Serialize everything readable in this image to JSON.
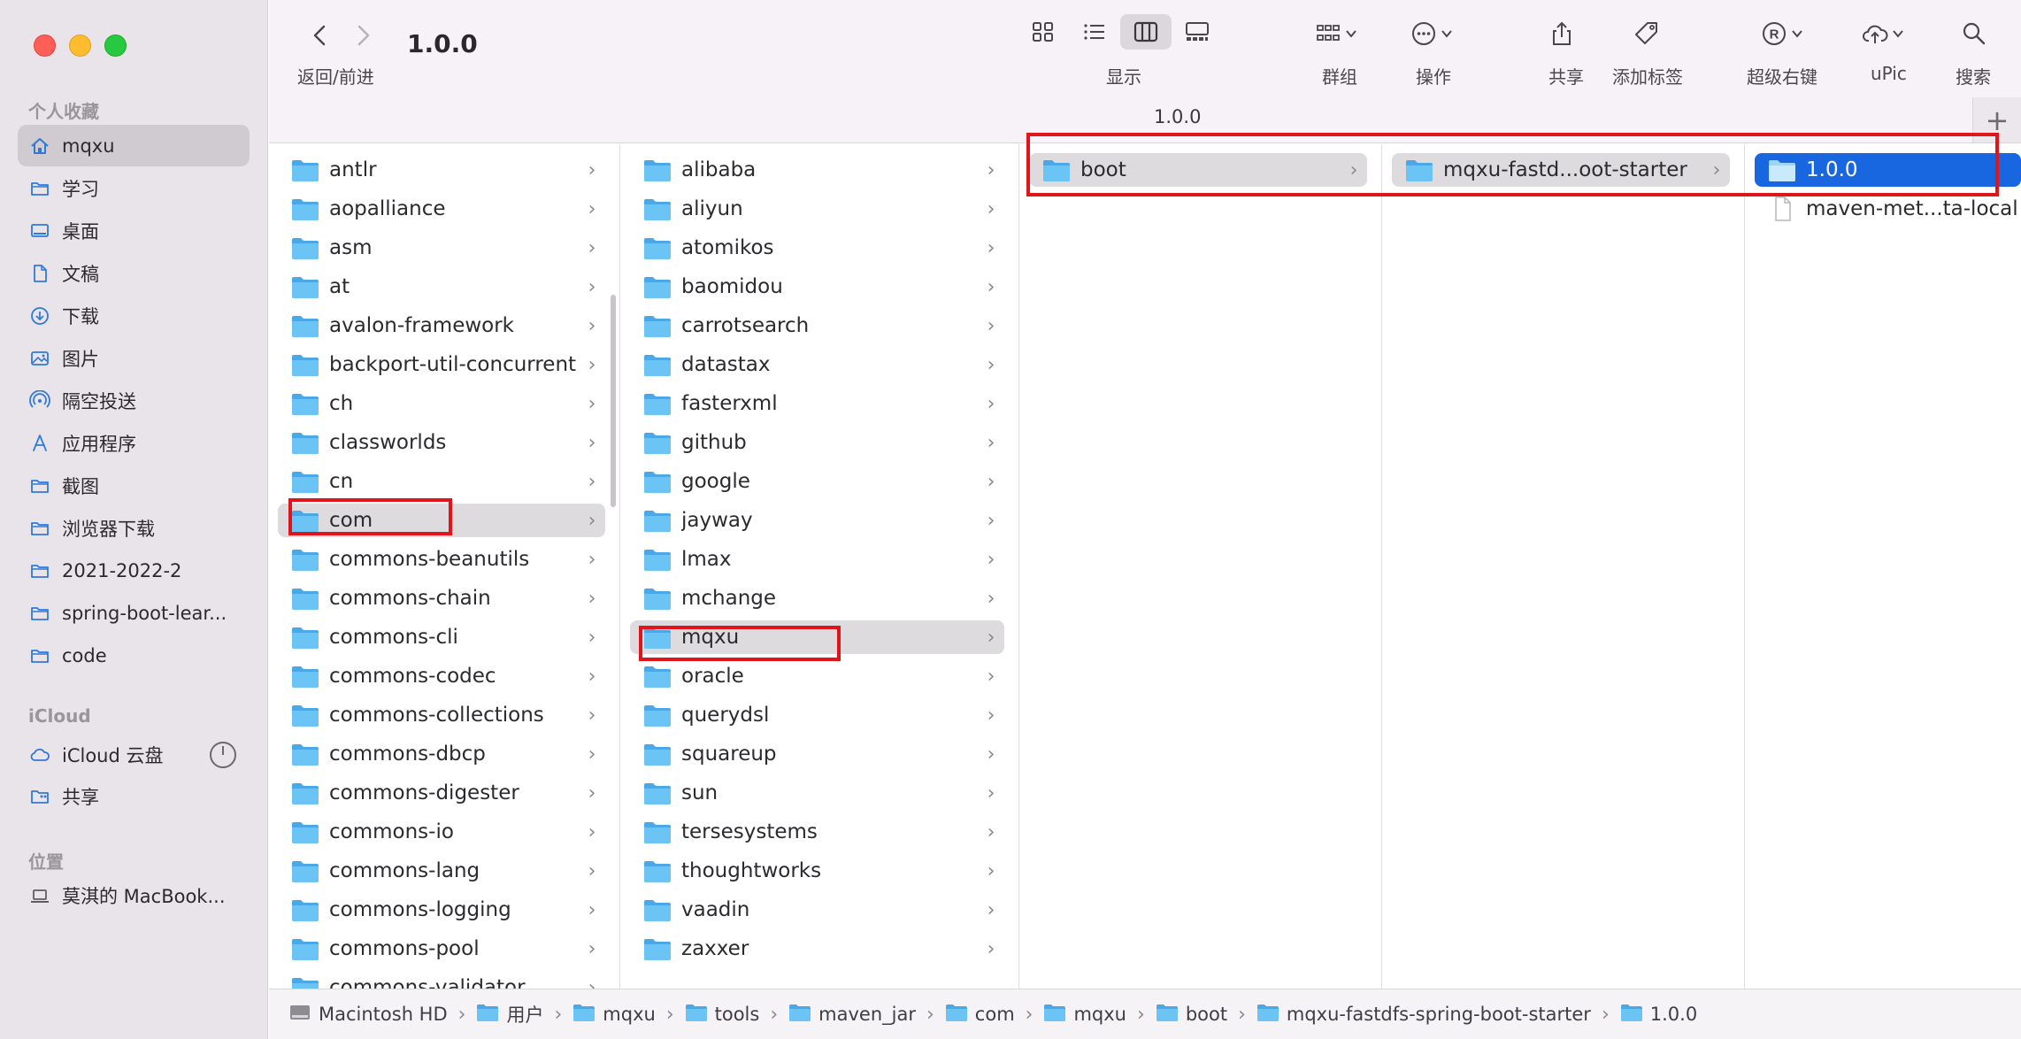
{
  "window": {
    "title": "1.0.0",
    "tab_title": "1.0.0",
    "nav_label": "返回/前进",
    "new_tab": "+"
  },
  "toolbar": {
    "view_label": "显示",
    "group_label": "群组",
    "action_label": "操作",
    "share_label": "共享",
    "tag_label": "添加标签",
    "rightclick_label": "超级右键",
    "upic_label": "uPic",
    "search_label": "搜索"
  },
  "sidebar": {
    "favorites_title": "个人收藏",
    "favorites": [
      {
        "label": "mqxu",
        "icon": "home-icon"
      },
      {
        "label": "学习",
        "icon": "folder-icon"
      },
      {
        "label": "桌面",
        "icon": "desktop-icon"
      },
      {
        "label": "文稿",
        "icon": "document-icon"
      },
      {
        "label": "下载",
        "icon": "download-icon"
      },
      {
        "label": "图片",
        "icon": "photo-icon"
      },
      {
        "label": "隔空投送",
        "icon": "airdrop-icon"
      },
      {
        "label": "应用程序",
        "icon": "applications-icon"
      },
      {
        "label": "截图",
        "icon": "folder-icon"
      },
      {
        "label": "浏览器下载",
        "icon": "folder-icon"
      },
      {
        "label": "2021-2022-2",
        "icon": "folder-icon"
      },
      {
        "label": "spring-boot-lear...",
        "icon": "folder-icon"
      },
      {
        "label": "code",
        "icon": "folder-icon"
      }
    ],
    "icloud_title": "iCloud",
    "icloud": [
      {
        "label": "iCloud 云盘",
        "icon": "cloud-icon"
      },
      {
        "label": "共享",
        "icon": "shared-folder-icon"
      }
    ],
    "locations_title": "位置",
    "locations": [
      {
        "label": "莫淇的 MacBook...",
        "icon": "laptop-icon"
      }
    ]
  },
  "columns": {
    "col1": [
      "antlr",
      "aopalliance",
      "asm",
      "at",
      "avalon-framework",
      "backport-util-concurrent",
      "ch",
      "classworlds",
      "cn",
      "com",
      "commons-beanutils",
      "commons-chain",
      "commons-cli",
      "commons-codec",
      "commons-collections",
      "commons-dbcp",
      "commons-digester",
      "commons-io",
      "commons-lang",
      "commons-logging",
      "commons-pool",
      "commons-validator"
    ],
    "col2": [
      "alibaba",
      "aliyun",
      "atomikos",
      "baomidou",
      "carrotsearch",
      "datastax",
      "fasterxml",
      "github",
      "google",
      "jayway",
      "lmax",
      "mchange",
      "mqxu",
      "oracle",
      "querydsl",
      "squareup",
      "sun",
      "tersesystems",
      "thoughtworks",
      "vaadin",
      "zaxxer"
    ],
    "col3": [
      "boot"
    ],
    "col4": [
      "mqxu-fastd...oot-starter"
    ],
    "col5_folder": "1.0.0",
    "col5_file": "maven-met...ta-local"
  },
  "pathbar": [
    "Macintosh HD",
    "用户",
    "mqxu",
    "tools",
    "maven_jar",
    "com",
    "mqxu",
    "boot",
    "mqxu-fastdfs-spring-boot-starter",
    "1.0.0"
  ],
  "colors": {
    "folder": "#5ab8ef",
    "selection_blue": "#1867e0",
    "selection_gray": "#dedbdf",
    "annotation_red": "#e0141b",
    "sidebar_bg": "#e9e3ea"
  }
}
